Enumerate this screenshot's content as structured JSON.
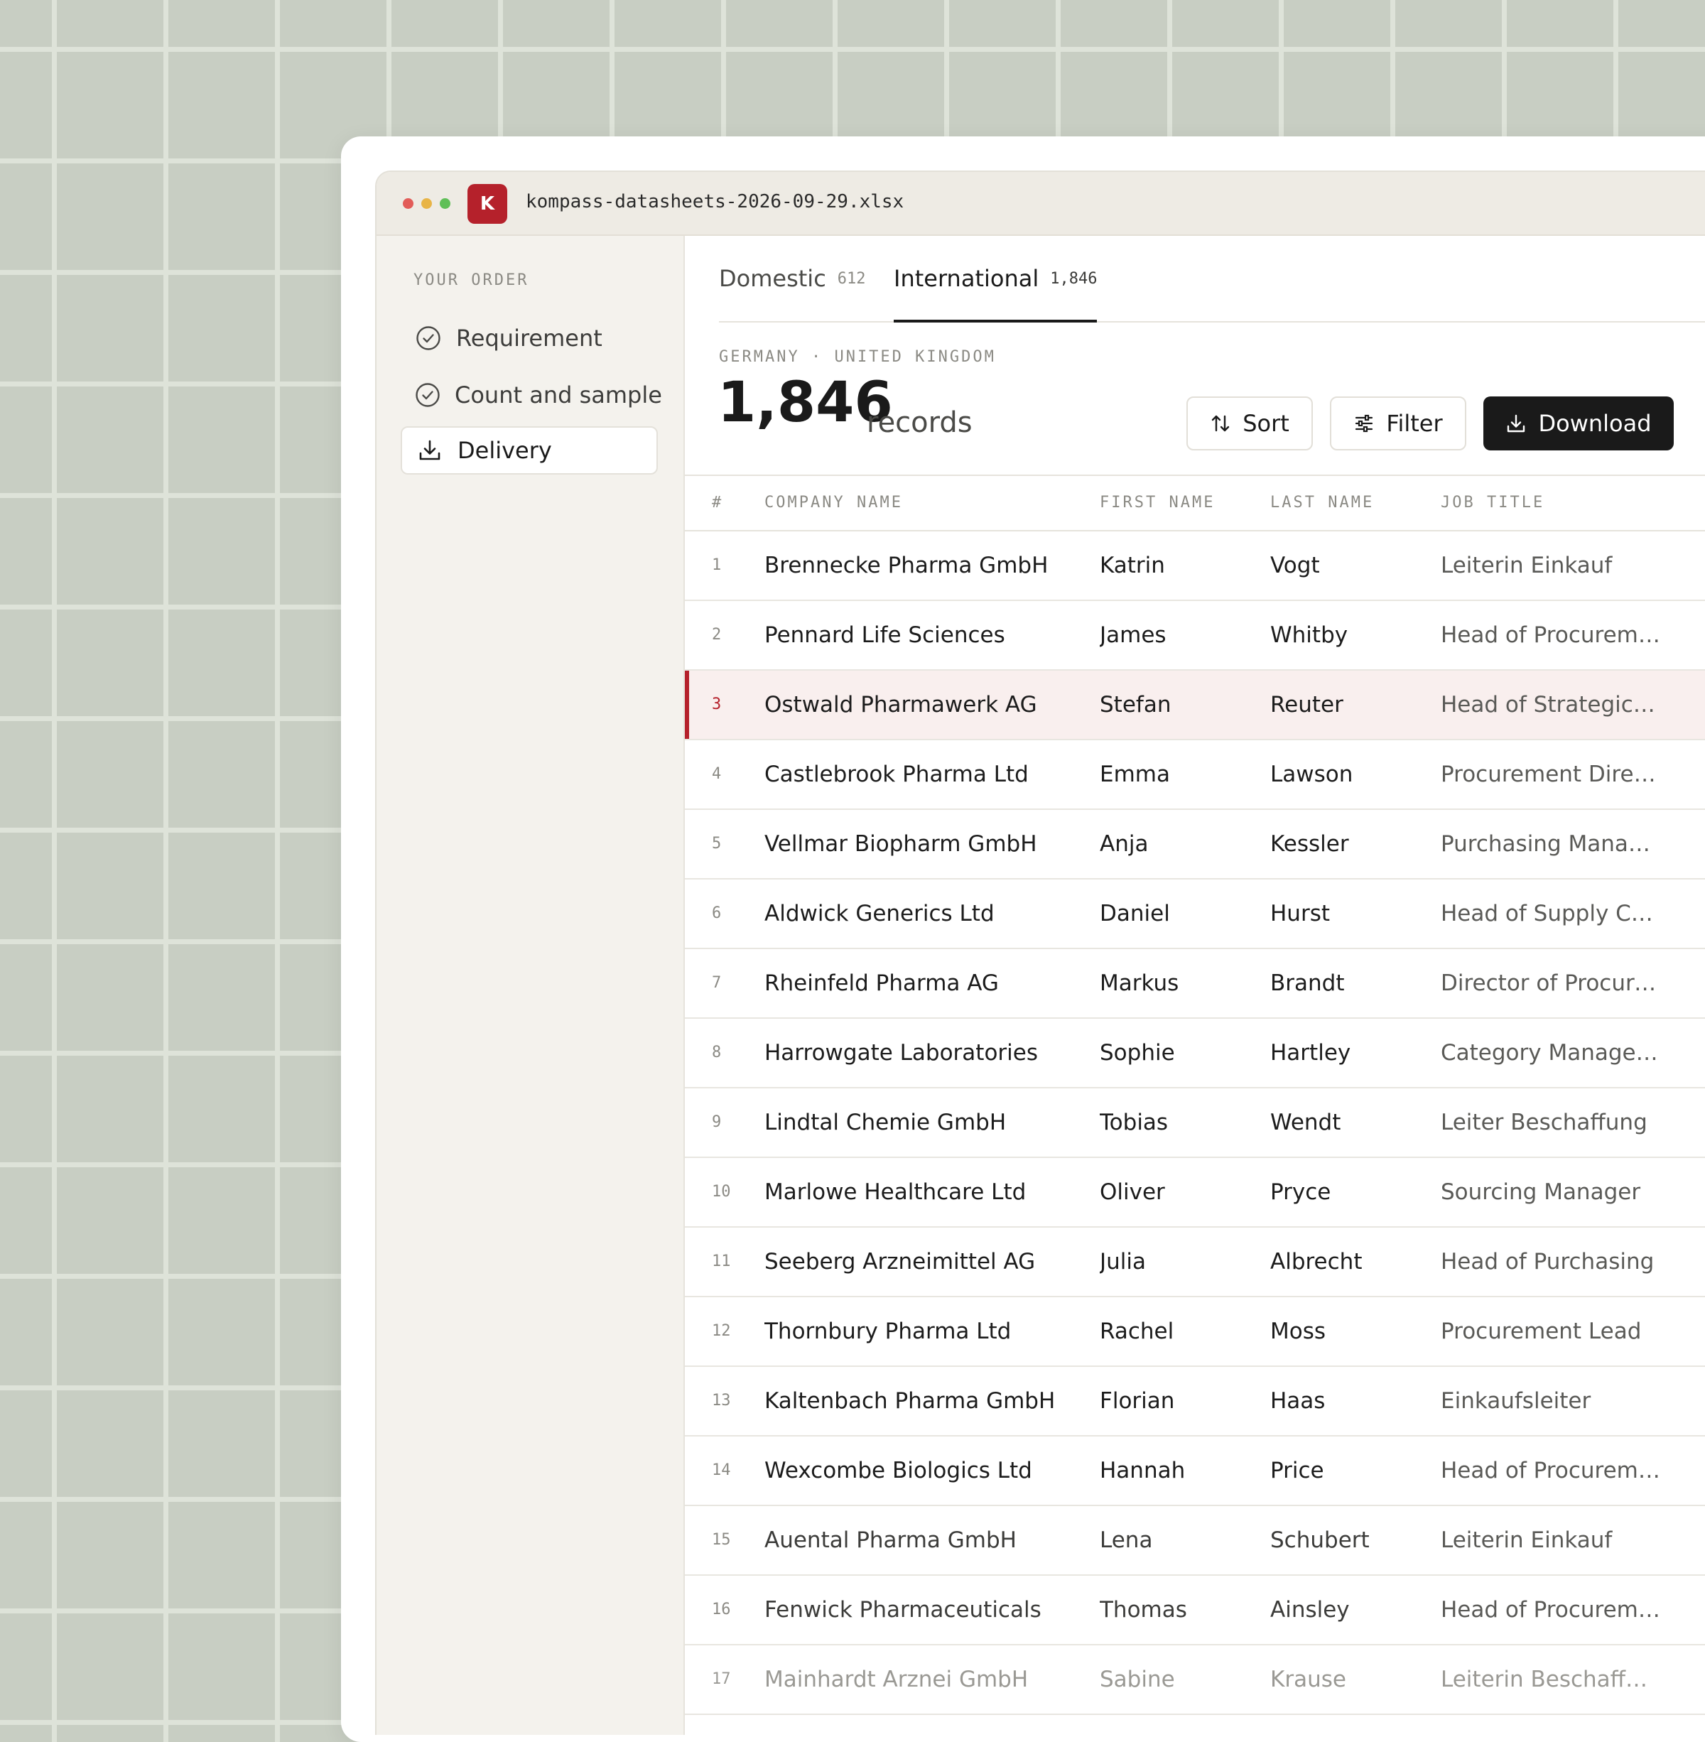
{
  "window": {
    "app_icon_letter": "K",
    "filename": "kompass-datasheets-2026-09-29.xlsx"
  },
  "sidebar": {
    "heading": "YOUR ORDER",
    "items": [
      {
        "label": "Requirement",
        "icon": "check-circle-icon",
        "state": "done"
      },
      {
        "label": "Count and sample",
        "icon": "check-circle-icon",
        "state": "done"
      },
      {
        "label": "Delivery",
        "icon": "download-icon",
        "state": "active"
      }
    ]
  },
  "tabs": [
    {
      "label": "Domestic",
      "count": "612",
      "active": false
    },
    {
      "label": "International",
      "count": "1,846",
      "active": true
    }
  ],
  "summary": {
    "region": "GERMANY · UNITED KINGDOM",
    "count": "1,846",
    "unit": "records"
  },
  "toolbar": {
    "sort_label": "Sort",
    "filter_label": "Filter",
    "download_label": "Download"
  },
  "table": {
    "columns": [
      "#",
      "COMPANY NAME",
      "FIRST NAME",
      "LAST NAME",
      "JOB TITLE"
    ],
    "selected_row": 3,
    "rows": [
      {
        "n": "1",
        "company": "Brennecke Pharma GmbH",
        "first": "Katrin",
        "last": "Vogt",
        "job": "Leiterin Einkauf"
      },
      {
        "n": "2",
        "company": "Pennard Life Sciences",
        "first": "James",
        "last": "Whitby",
        "job": "Head of Procurement"
      },
      {
        "n": "3",
        "company": "Ostwald Pharmawerk AG",
        "first": "Stefan",
        "last": "Reuter",
        "job": "Head of Strategic S..."
      },
      {
        "n": "4",
        "company": "Castlebrook Pharma Ltd",
        "first": "Emma",
        "last": "Lawson",
        "job": "Procurement Direct..."
      },
      {
        "n": "5",
        "company": "Vellmar Biopharm GmbH",
        "first": "Anja",
        "last": "Kessler",
        "job": "Purchasing Manager"
      },
      {
        "n": "6",
        "company": "Aldwick Generics Ltd",
        "first": "Daniel",
        "last": "Hurst",
        "job": "Head of Supply Cha..."
      },
      {
        "n": "7",
        "company": "Rheinfeld Pharma AG",
        "first": "Markus",
        "last": "Brandt",
        "job": "Director of Procure..."
      },
      {
        "n": "8",
        "company": "Harrowgate Laboratories",
        "first": "Sophie",
        "last": "Hartley",
        "job": "Category Manager, ..."
      },
      {
        "n": "9",
        "company": "Lindtal Chemie GmbH",
        "first": "Tobias",
        "last": "Wendt",
        "job": "Leiter Beschaffung"
      },
      {
        "n": "10",
        "company": "Marlowe Healthcare Ltd",
        "first": "Oliver",
        "last": "Pryce",
        "job": "Sourcing Manager"
      },
      {
        "n": "11",
        "company": "Seeberg Arzneimittel AG",
        "first": "Julia",
        "last": "Albrecht",
        "job": "Head of Purchasing"
      },
      {
        "n": "12",
        "company": "Thornbury Pharma Ltd",
        "first": "Rachel",
        "last": "Moss",
        "job": "Procurement Lead"
      },
      {
        "n": "13",
        "company": "Kaltenbach Pharma GmbH",
        "first": "Florian",
        "last": "Haas",
        "job": "Einkaufsleiter"
      },
      {
        "n": "14",
        "company": "Wexcombe Biologics Ltd",
        "first": "Hannah",
        "last": "Price",
        "job": "Head of Procurement"
      },
      {
        "n": "15",
        "company": "Auental Pharma GmbH",
        "first": "Lena",
        "last": "Schubert",
        "job": "Leiterin Einkauf"
      },
      {
        "n": "16",
        "company": "Fenwick Pharmaceuticals",
        "first": "Thomas",
        "last": "Ainsley",
        "job": "Head of Procurement"
      },
      {
        "n": "17",
        "company": "Mainhardt Arznei GmbH",
        "first": "Sabine",
        "last": "Krause",
        "job": "Leiterin Beschaffung"
      }
    ]
  },
  "colors": {
    "accent": "#b5212b",
    "background": "#c8cec3",
    "dark_button": "#1a1a1a"
  }
}
